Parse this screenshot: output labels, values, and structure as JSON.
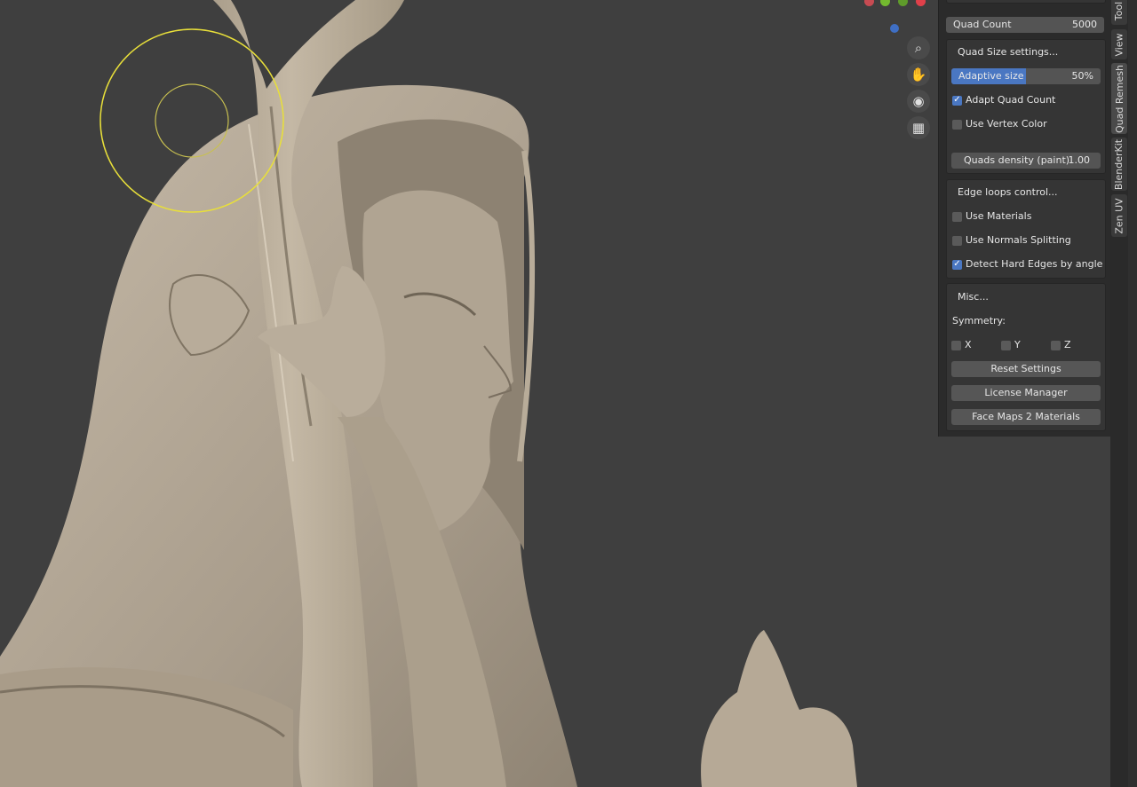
{
  "sidebar": {
    "quad_count": {
      "label": "Quad Count",
      "value": "5000"
    },
    "quad_size": {
      "header": "Quad Size settings...",
      "adaptive": {
        "label": "Adaptive size",
        "value": "50%",
        "fraction": 0.5
      },
      "adapt_quad_count": {
        "label": "Adapt Quad Count",
        "checked": true
      },
      "use_vertex_color": {
        "label": "Use Vertex Color",
        "checked": false
      },
      "density": {
        "label": "Quads density (paint)",
        "value": "1.00"
      }
    },
    "edge_loops": {
      "header": "Edge loops control...",
      "use_materials": {
        "label": "Use Materials",
        "checked": false
      },
      "use_normals": {
        "label": "Use Normals Splitting",
        "checked": false
      },
      "detect_hard": {
        "label": "Detect Hard Edges by angle",
        "checked": true
      }
    },
    "misc": {
      "header": "Misc...",
      "symmetry_label": "Symmetry:",
      "x": "X",
      "y": "Y",
      "z": "Z",
      "reset": "Reset Settings",
      "license": "License Manager",
      "facemaps": "Face Maps 2 Materials"
    }
  },
  "tabs": [
    "Tool",
    "View",
    "Quad Remesh",
    "BlenderKit",
    "Zen UV"
  ],
  "active_tab": "Quad Remesh",
  "colors": {
    "accent": "#4a77c2",
    "brush_circle": "#e8df3a",
    "sculpt_clay": "#b7ab99"
  }
}
